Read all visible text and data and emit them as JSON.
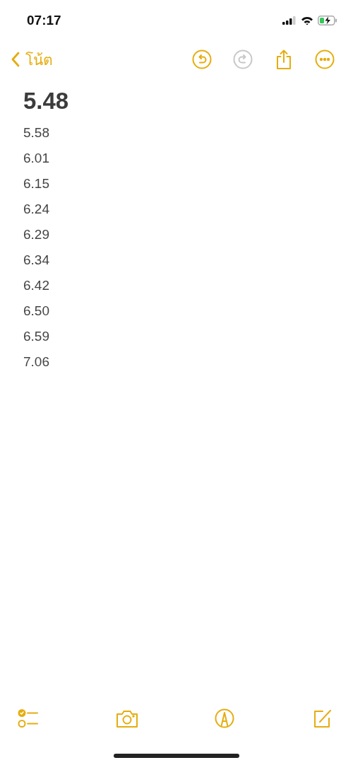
{
  "status_bar": {
    "time": "07:17"
  },
  "nav_bar": {
    "back_label": "โน้ต",
    "actions": [
      {
        "kind": "undo",
        "disabled": false
      },
      {
        "kind": "redo",
        "disabled": true
      },
      {
        "kind": "share",
        "disabled": false
      },
      {
        "kind": "more",
        "disabled": false
      }
    ]
  },
  "note": {
    "title": "5.48",
    "lines": [
      "5.58",
      "6.01",
      "6.15",
      "6.24",
      "6.29",
      "6.34",
      "6.42",
      "6.50",
      "6.59",
      "7.06"
    ]
  },
  "toolbar": [
    {
      "kind": "checklist"
    },
    {
      "kind": "camera"
    },
    {
      "kind": "markup"
    },
    {
      "kind": "compose"
    }
  ]
}
